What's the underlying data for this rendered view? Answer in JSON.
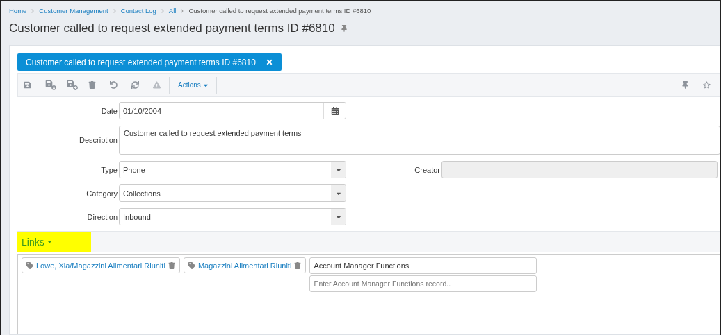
{
  "breadcrumb": [
    {
      "label": "Home",
      "link": true
    },
    {
      "label": "Customer Management",
      "link": true
    },
    {
      "label": "Contact Log",
      "link": true
    },
    {
      "label": "All",
      "link": true
    },
    {
      "label": "Customer called to request extended payment terms ID #6810",
      "link": false
    }
  ],
  "page_title": "Customer called to request extended payment terms ID #6810",
  "record_tab": {
    "label": "Customer called to request extended payment terms ID #6810",
    "selected": true
  },
  "toolbar": {
    "actions_label": "Actions"
  },
  "form": {
    "date": {
      "label": "Date",
      "value": "01/10/2004"
    },
    "description": {
      "label": "Description",
      "value": "Customer called to request extended payment terms"
    },
    "type": {
      "label": "Type",
      "value": "Phone"
    },
    "creator": {
      "label": "Creator"
    },
    "category": {
      "label": "Category",
      "value": "Collections"
    },
    "direction": {
      "label": "Direction",
      "value": "Inbound"
    }
  },
  "links": {
    "label": "Links",
    "expanded": true,
    "highlighted": true,
    "tags": [
      {
        "label": "Lowe, Xia/Magazzini Alimentari Riuniti"
      },
      {
        "label": "Magazzini Alimentari Riuniti"
      }
    ],
    "lookup": {
      "value": "Account Manager Functions",
      "placeholder": "Enter Account Manager Functions record.."
    }
  }
}
